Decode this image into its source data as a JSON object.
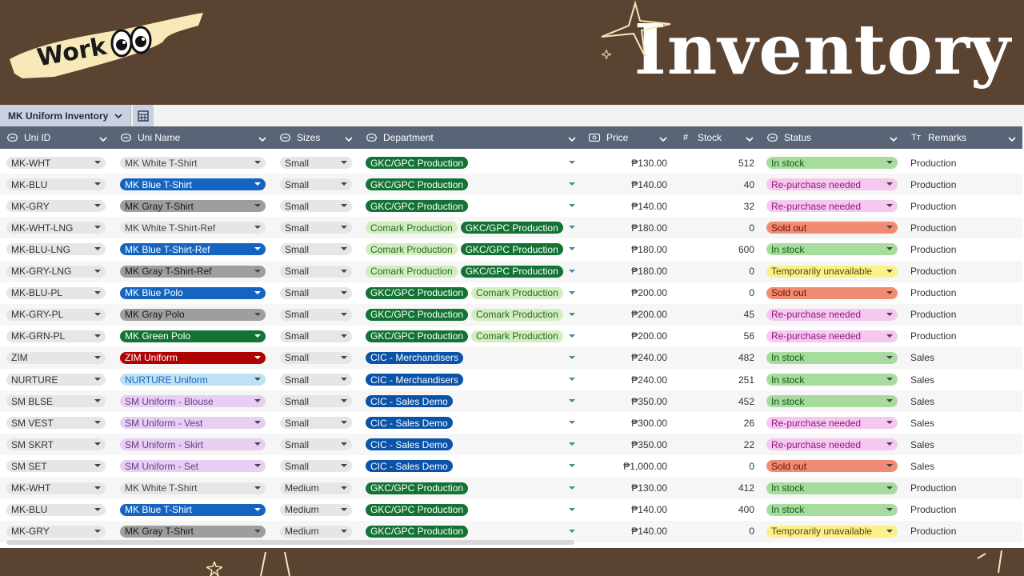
{
  "header": {
    "sticker_text": "Work",
    "title": "Inventory"
  },
  "view": {
    "name": "MK Uniform Inventory"
  },
  "columns": [
    {
      "label": "Uni ID",
      "icon": "option-icon"
    },
    {
      "label": "Uni Name",
      "icon": "option-icon"
    },
    {
      "label": "Sizes",
      "icon": "option-icon"
    },
    {
      "label": "Department",
      "icon": "option-icon"
    },
    {
      "label": "Price",
      "icon": "currency-icon"
    },
    {
      "label": "Stock",
      "icon": "hash-icon"
    },
    {
      "label": "Status",
      "icon": "option-icon"
    },
    {
      "label": "Remarks",
      "icon": "text-icon"
    }
  ],
  "colors": {
    "blue": "#1565c0",
    "gray": "#9e9e9e",
    "green": "#137333",
    "red": "#b10202",
    "lightblue": "#bfe1f6",
    "lavender": "#e6cff2",
    "white": "#e6e6e6",
    "dept_green": "#137333",
    "dept_light": "#d4edbc",
    "dept_cic": "#0a53a8",
    "in_stock": "#a8dc9e",
    "repurchase": "#f6c7ef",
    "sold_out": "#f08b74",
    "unavailable": "#fbf08a"
  },
  "rows": [
    {
      "id": "MK-WHT",
      "name": "MK White T-Shirt",
      "name_color": "white",
      "size": "Small",
      "depts": [
        "GKC/GPC Production"
      ],
      "price": "₱130.00",
      "stock": "512",
      "status": "In stock",
      "remarks": "Production"
    },
    {
      "id": "MK-BLU",
      "name": "MK Blue T-Shirt",
      "name_color": "blue",
      "size": "Small",
      "depts": [
        "GKC/GPC Production"
      ],
      "price": "₱140.00",
      "stock": "40",
      "status": "Re-purchase needed",
      "remarks": "Production"
    },
    {
      "id": "MK-GRY",
      "name": "MK Gray T-Shirt",
      "name_color": "gray",
      "size": "Small",
      "depts": [
        "GKC/GPC Production"
      ],
      "price": "₱140.00",
      "stock": "32",
      "status": "Re-purchase needed",
      "remarks": "Production"
    },
    {
      "id": "MK-WHT-LNG",
      "name": "MK White T-Shirt-Ref",
      "name_color": "white",
      "size": "Small",
      "depts": [
        "Comark Production",
        "GKC/GPC Production"
      ],
      "price": "₱180.00",
      "stock": "0",
      "status": "Sold out",
      "remarks": "Production"
    },
    {
      "id": "MK-BLU-LNG",
      "name": "MK Blue T-Shirt-Ref",
      "name_color": "blue",
      "size": "Small",
      "depts": [
        "Comark Production",
        "GKC/GPC Production"
      ],
      "price": "₱180.00",
      "stock": "600",
      "status": "In stock",
      "remarks": "Production"
    },
    {
      "id": "MK-GRY-LNG",
      "name": "MK Gray T-Shirt-Ref",
      "name_color": "gray",
      "size": "Small",
      "depts": [
        "Comark Production",
        "GKC/GPC Production"
      ],
      "price": "₱180.00",
      "stock": "0",
      "status": "Temporarily unavailable",
      "remarks": "Production"
    },
    {
      "id": "MK-BLU-PL",
      "name": "MK Blue Polo",
      "name_color": "blue",
      "size": "Small",
      "depts": [
        "GKC/GPC Production",
        "Comark Production"
      ],
      "price": "₱200.00",
      "stock": "0",
      "status": "Sold out",
      "remarks": "Production"
    },
    {
      "id": "MK-GRY-PL",
      "name": "MK Gray Polo",
      "name_color": "gray",
      "size": "Small",
      "depts": [
        "GKC/GPC Production",
        "Comark Production"
      ],
      "price": "₱200.00",
      "stock": "45",
      "status": "Re-purchase needed",
      "remarks": "Production"
    },
    {
      "id": "MK-GRN-PL",
      "name": "MK Green Polo",
      "name_color": "green",
      "size": "Small",
      "depts": [
        "GKC/GPC Production",
        "Comark Production"
      ],
      "price": "₱200.00",
      "stock": "56",
      "status": "Re-purchase needed",
      "remarks": "Production"
    },
    {
      "id": "ZIM",
      "name": "ZIM Uniform",
      "name_color": "red",
      "size": "Small",
      "depts": [
        "CIC - Merchandisers"
      ],
      "price": "₱240.00",
      "stock": "482",
      "status": "In stock",
      "remarks": "Sales"
    },
    {
      "id": "NURTURE",
      "name": "NURTURE Uniform",
      "name_color": "lightblue",
      "size": "Small",
      "depts": [
        "CIC - Merchandisers"
      ],
      "price": "₱240.00",
      "stock": "251",
      "status": "In stock",
      "remarks": "Sales"
    },
    {
      "id": "SM BLSE",
      "name": "SM Uniform - Blouse",
      "name_color": "lavender",
      "size": "Small",
      "depts": [
        "CIC - Sales Demo"
      ],
      "price": "₱350.00",
      "stock": "452",
      "status": "In stock",
      "remarks": "Sales"
    },
    {
      "id": "SM VEST",
      "name": "SM Uniform - Vest",
      "name_color": "lavender",
      "size": "Small",
      "depts": [
        "CIC - Sales Demo"
      ],
      "price": "₱300.00",
      "stock": "26",
      "status": "Re-purchase needed",
      "remarks": "Sales"
    },
    {
      "id": "SM SKRT",
      "name": "SM Uniform - Skirt",
      "name_color": "lavender",
      "size": "Small",
      "depts": [
        "CIC - Sales Demo"
      ],
      "price": "₱350.00",
      "stock": "22",
      "status": "Re-purchase needed",
      "remarks": "Sales"
    },
    {
      "id": "SM SET",
      "name": "SM Uniform - Set",
      "name_color": "lavender",
      "size": "Small",
      "depts": [
        "CIC - Sales Demo"
      ],
      "price": "₱1,000.00",
      "stock": "0",
      "status": "Sold out",
      "remarks": "Sales"
    },
    {
      "id": "MK-WHT",
      "name": "MK White T-Shirt",
      "name_color": "white",
      "size": "Medium",
      "depts": [
        "GKC/GPC Production"
      ],
      "price": "₱130.00",
      "stock": "412",
      "status": "In stock",
      "remarks": "Production"
    },
    {
      "id": "MK-BLU",
      "name": "MK Blue T-Shirt",
      "name_color": "blue",
      "size": "Medium",
      "depts": [
        "GKC/GPC Production"
      ],
      "price": "₱140.00",
      "stock": "400",
      "status": "In stock",
      "remarks": "Production"
    },
    {
      "id": "MK-GRY",
      "name": "MK Gray T-Shirt",
      "name_color": "gray",
      "size": "Medium",
      "depts": [
        "GKC/GPC Production"
      ],
      "price": "₱140.00",
      "stock": "0",
      "status": "Temporarily unavailable",
      "remarks": "Production"
    }
  ]
}
